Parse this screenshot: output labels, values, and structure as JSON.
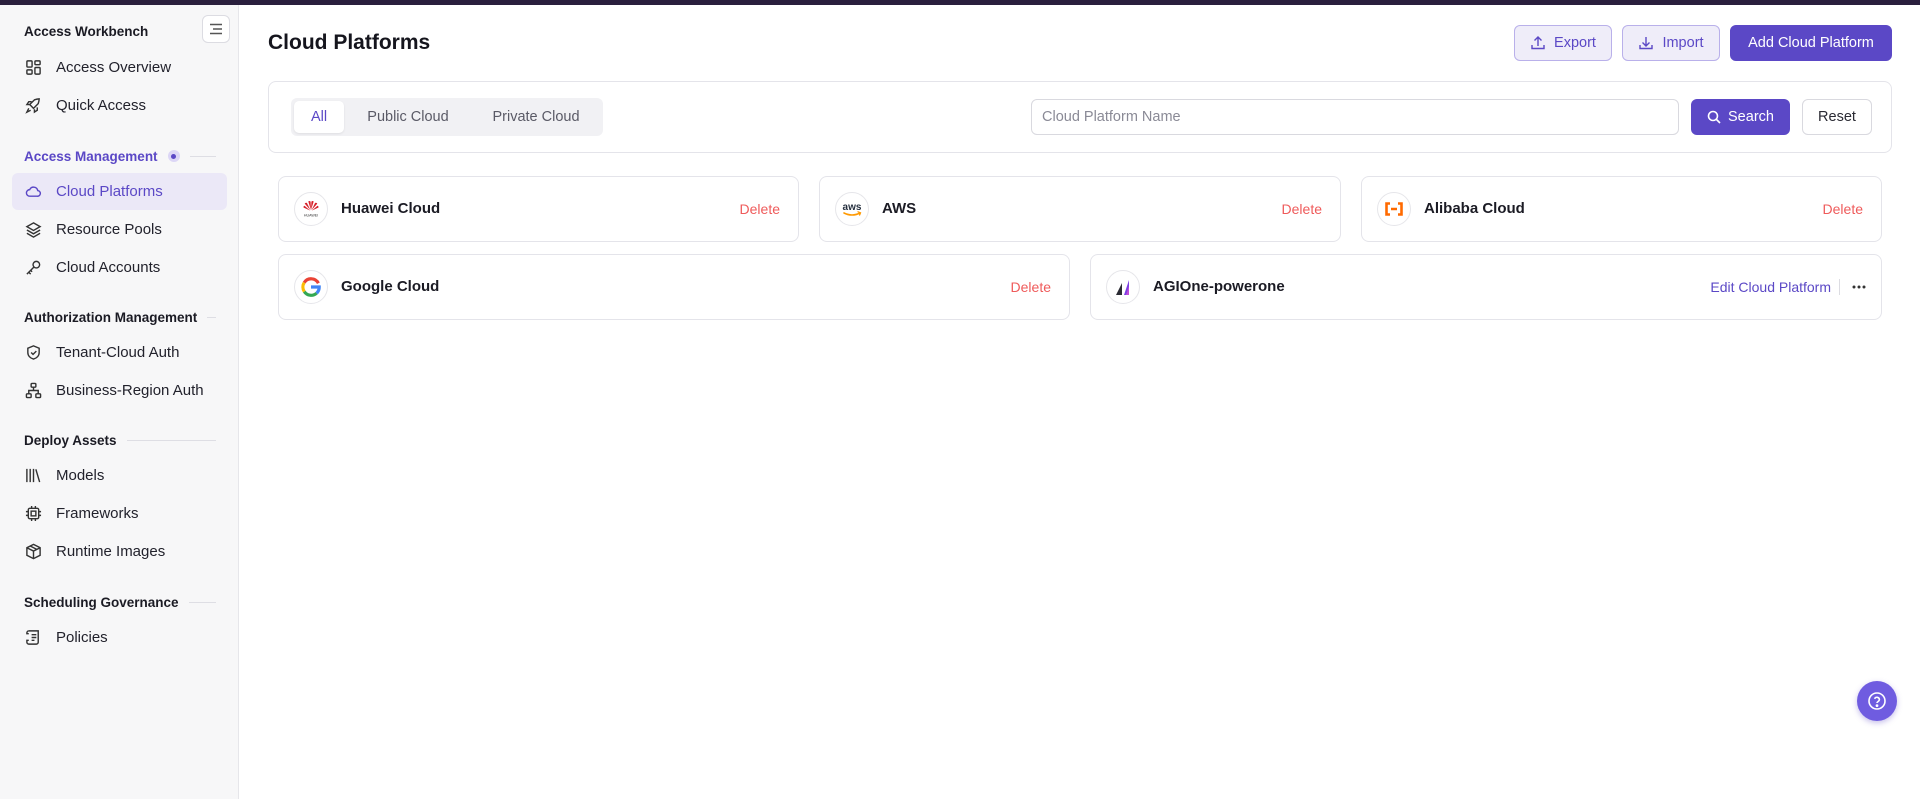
{
  "sidebar": {
    "title": "Access Workbench",
    "top_items": [
      {
        "label": "Access Overview",
        "icon": "dashboard-icon"
      },
      {
        "label": "Quick Access",
        "icon": "rocket-icon"
      }
    ],
    "groups": [
      {
        "title": "Access Management",
        "items": [
          {
            "label": "Cloud Platforms",
            "icon": "cloud-icon",
            "active": true
          },
          {
            "label": "Resource Pools",
            "icon": "layers-icon"
          },
          {
            "label": "Cloud Accounts",
            "icon": "key-icon"
          }
        ]
      },
      {
        "title": "Authorization Management",
        "items": [
          {
            "label": "Tenant-Cloud Auth",
            "icon": "shield-check-icon"
          },
          {
            "label": "Business-Region Auth",
            "icon": "network-icon"
          }
        ]
      },
      {
        "title": "Deploy Assets",
        "items": [
          {
            "label": "Models",
            "icon": "library-icon"
          },
          {
            "label": "Frameworks",
            "icon": "chip-icon"
          },
          {
            "label": "Runtime Images",
            "icon": "package-icon"
          }
        ]
      },
      {
        "title": "Scheduling Governance",
        "items": [
          {
            "label": "Policies",
            "icon": "scroll-icon"
          }
        ]
      }
    ]
  },
  "header": {
    "title": "Cloud Platforms",
    "export_label": "Export",
    "import_label": "Import",
    "add_label": "Add Cloud Platform"
  },
  "filter": {
    "tabs": [
      "All",
      "Public Cloud",
      "Private Cloud"
    ],
    "active_tab": "All",
    "search_placeholder": "Cloud Platform Name",
    "search_value": "",
    "search_label": "Search",
    "reset_label": "Reset"
  },
  "platforms": [
    {
      "name": "Huawei Cloud",
      "logo": "huawei-logo-icon",
      "action": "Delete"
    },
    {
      "name": "AWS",
      "logo": "aws-logo-icon",
      "action": "Delete"
    },
    {
      "name": "Alibaba Cloud",
      "logo": "alibaba-logo-icon",
      "action": "Delete"
    },
    {
      "name": "Google Cloud",
      "logo": "google-logo-icon",
      "action": "Delete"
    },
    {
      "name": "AGIOne-powerone",
      "logo": "agione-logo-icon",
      "action": "Edit Cloud Platform"
    }
  ],
  "logo_text": {
    "huawei": "HUAWEI",
    "aws": "aws"
  },
  "colors": {
    "accent": "#5b48c6",
    "danger": "#ef5b5b",
    "active_nav_bg": "#ebe8f7",
    "sidebar_bg": "#f7f7f8"
  }
}
